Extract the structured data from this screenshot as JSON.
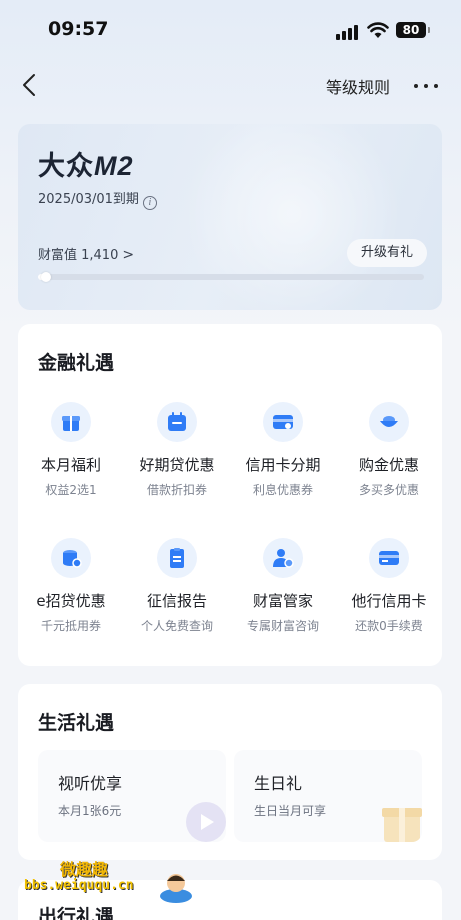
{
  "status_bar": {
    "time": "09:57",
    "battery": "80"
  },
  "nav": {
    "rules_label": "等级规则"
  },
  "level": {
    "name_prefix": "大众",
    "name_suffix": "M2",
    "expiry": "2025/03/01到期",
    "info_glyph": "i",
    "wealth_label": "财富值 1,410",
    "wealth_chevron": ">",
    "upgrade_label": "升级有礼",
    "progress_fraction": 0.02
  },
  "finance": {
    "title": "金融礼遇",
    "items": [
      {
        "title": "本月福利",
        "sub": "权益2选1",
        "icon": "gift-icon"
      },
      {
        "title": "好期贷优惠",
        "sub": "借款折扣券",
        "icon": "calendar-icon"
      },
      {
        "title": "信用卡分期",
        "sub": "利息优惠券",
        "icon": "card-installment-icon"
      },
      {
        "title": "购金优惠",
        "sub": "多买多优惠",
        "icon": "gold-ingot-icon"
      },
      {
        "title": "e招贷优惠",
        "sub": "千元抵用券",
        "icon": "coins-icon"
      },
      {
        "title": "征信报告",
        "sub": "个人免费查询",
        "icon": "report-icon"
      },
      {
        "title": "财富管家",
        "sub": "专属财富咨询",
        "icon": "advisor-icon"
      },
      {
        "title": "他行信用卡",
        "sub": "还款0手续费",
        "icon": "credit-card-icon"
      }
    ]
  },
  "life": {
    "title": "生活礼遇",
    "cards": [
      {
        "title": "视听优享",
        "desc": "本月1张6元",
        "icon": "play-icon"
      },
      {
        "title": "生日礼",
        "desc": "生日当月可享",
        "icon": "gift-box-icon"
      }
    ]
  },
  "travel": {
    "title": "出行礼遇"
  },
  "watermark": {
    "line1": "微趣趣",
    "line2": "bbs.weiququ.cn"
  },
  "colors": {
    "accent": "#2f7cf6",
    "icon_bg": "#eaf2fd"
  }
}
